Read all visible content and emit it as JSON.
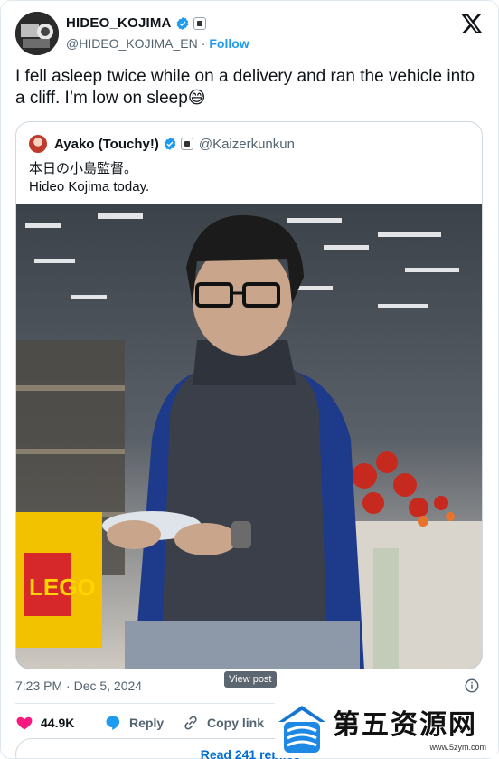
{
  "author": {
    "display_name": "HIDEO_KOJIMA",
    "handle": "@HIDEO_KOJIMA_EN",
    "separator": "·",
    "follow_label": "Follow"
  },
  "tweet": {
    "text": "I fell asleep twice while on a delivery and ran the vehicle into a cliff. I’m low on sleep😅"
  },
  "quoted": {
    "display_name": "Ayako (Touchy!)",
    "handle": "@Kaizerkunkun",
    "text_line1": "本日の小島監督。",
    "text_line2": "Hideo Kojima today."
  },
  "meta": {
    "timestamp": "7:23 PM · Dec 5, 2024",
    "tooltip": "View post"
  },
  "actions": {
    "likes_count": "44.9K",
    "reply_label": "Reply",
    "copy_link_label": "Copy link"
  },
  "read_replies_label": "Read 241 replies",
  "watermark": {
    "title": "第五资源网",
    "url": "www.5zym.com"
  },
  "colors": {
    "accent": "#1d9bf0",
    "like": "#f91880",
    "text": "#0f1419",
    "muted": "#536471"
  },
  "icons": [
    "verified-badge-icon",
    "affiliate-badge-icon",
    "x-logo-icon",
    "info-icon",
    "heart-icon",
    "reply-icon",
    "link-icon"
  ]
}
